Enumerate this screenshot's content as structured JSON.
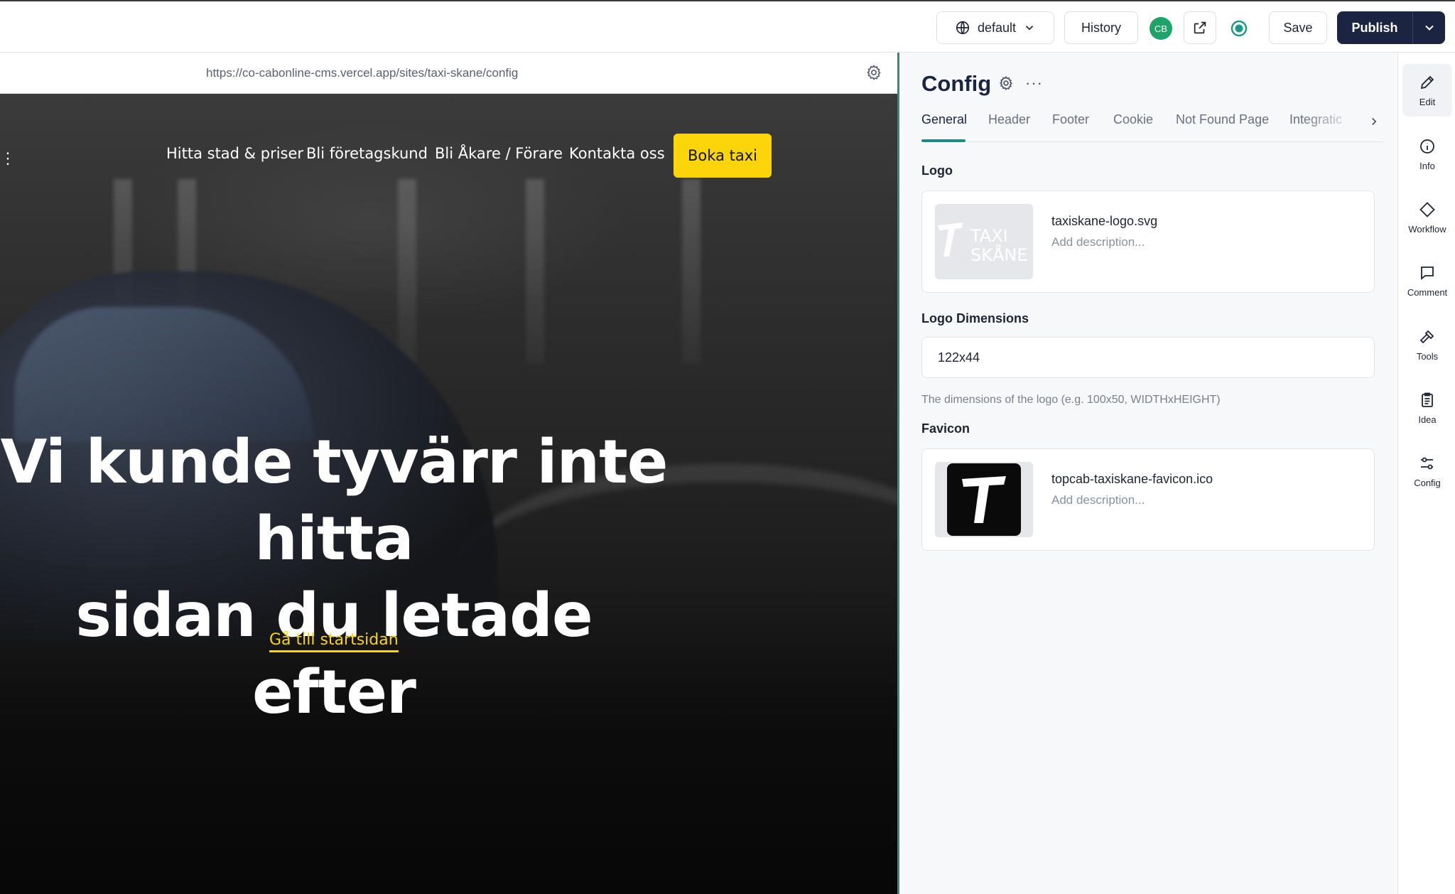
{
  "toolbar": {
    "locale_label": "default",
    "history_label": "History",
    "avatar_initials": "CB",
    "save_label": "Save",
    "publish_label": "Publish",
    "accent_color": "#1b2541",
    "live_color": "#1ea468"
  },
  "preview": {
    "url": "https://co-cabonline-cms.vercel.app/sites/taxi-skane/config",
    "nav": {
      "links": [
        "Hitta stad & priser",
        "Bli företagskund",
        "Bli Åkare / Förare",
        "Kontakta oss"
      ],
      "cta_label": "Boka taxi"
    },
    "headline_line1": "Vi kunde tyvärr inte hitta",
    "headline_line2": "sidan du letade efter",
    "home_link": "Gå till startsidan",
    "brand_yellow": "#fbd40a"
  },
  "panel": {
    "title": "Config",
    "more_label": "···",
    "tabs": [
      "General",
      "Header",
      "Footer",
      "Cookie",
      "Not Found Page",
      "Integratic"
    ],
    "active_tab": "General",
    "logo": {
      "label": "Logo",
      "file_name": "taxiskane-logo.svg",
      "description_placeholder": "Add description...",
      "thumb_text_1": "TAXI",
      "thumb_text_2": "SKÅNE"
    },
    "logo_dimensions": {
      "label": "Logo Dimensions",
      "value": "122x44",
      "help": "The dimensions of the logo (e.g. 100x50, WIDTHxHEIGHT)"
    },
    "favicon": {
      "label": "Favicon",
      "file_name": "topcab-taxiskane-favicon.ico",
      "description_placeholder": "Add description..."
    }
  },
  "rail": {
    "items": [
      {
        "label": "Edit",
        "icon": "pencil-icon"
      },
      {
        "label": "Info",
        "icon": "info-icon"
      },
      {
        "label": "Workflow",
        "icon": "diamond-icon"
      },
      {
        "label": "Comment",
        "icon": "comment-icon"
      },
      {
        "label": "Tools",
        "icon": "hammer-icon"
      },
      {
        "label": "Idea",
        "icon": "clipboard-icon"
      },
      {
        "label": "Config",
        "icon": "sliders-icon"
      }
    ]
  }
}
